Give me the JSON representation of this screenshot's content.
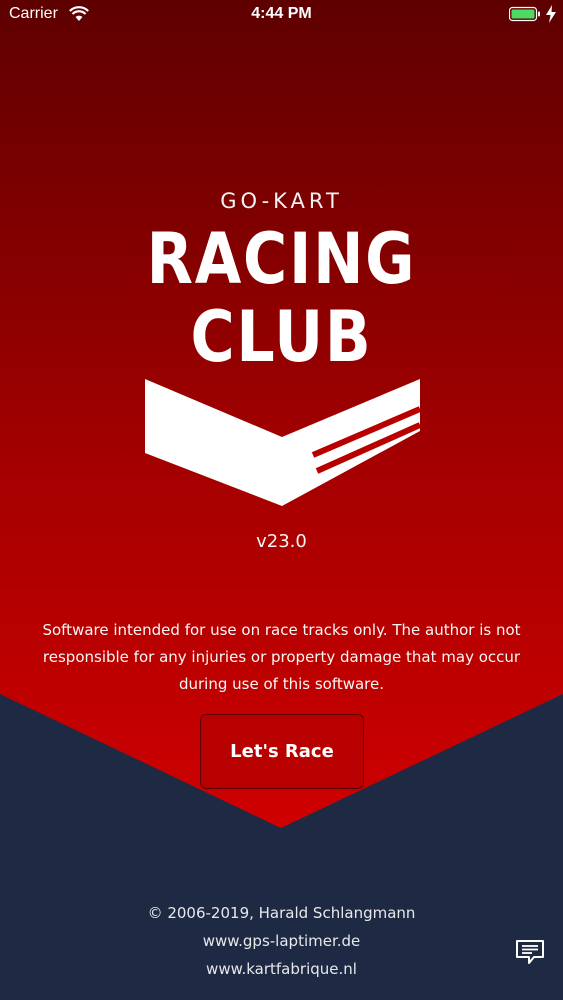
{
  "status_bar": {
    "carrier": "Carrier",
    "time": "4:44 PM",
    "icons": [
      "wifi-icon",
      "battery-icon",
      "charging-icon"
    ]
  },
  "logo": {
    "subtitle": "GO-KART",
    "line1": "RACING",
    "line2": "CLUB"
  },
  "version": "v23.0",
  "disclaimer": "Software intended for use on race tracks only. The author is not responsible for any injuries or property damage that may occur during use of this software.",
  "actions": {
    "start_label": "Let's Race",
    "chat_icon": "chat-bubble-icon"
  },
  "footer": {
    "copyright": "© 2006-2019, Harald Schlangmann",
    "links": [
      "www.gps-laptimer.de",
      "www.kartfabrique.nl"
    ]
  },
  "colors": {
    "top_red": "#5e0000",
    "mid_red": "#c80000",
    "navy": "#1e2a44",
    "button_red": "#b90000"
  }
}
